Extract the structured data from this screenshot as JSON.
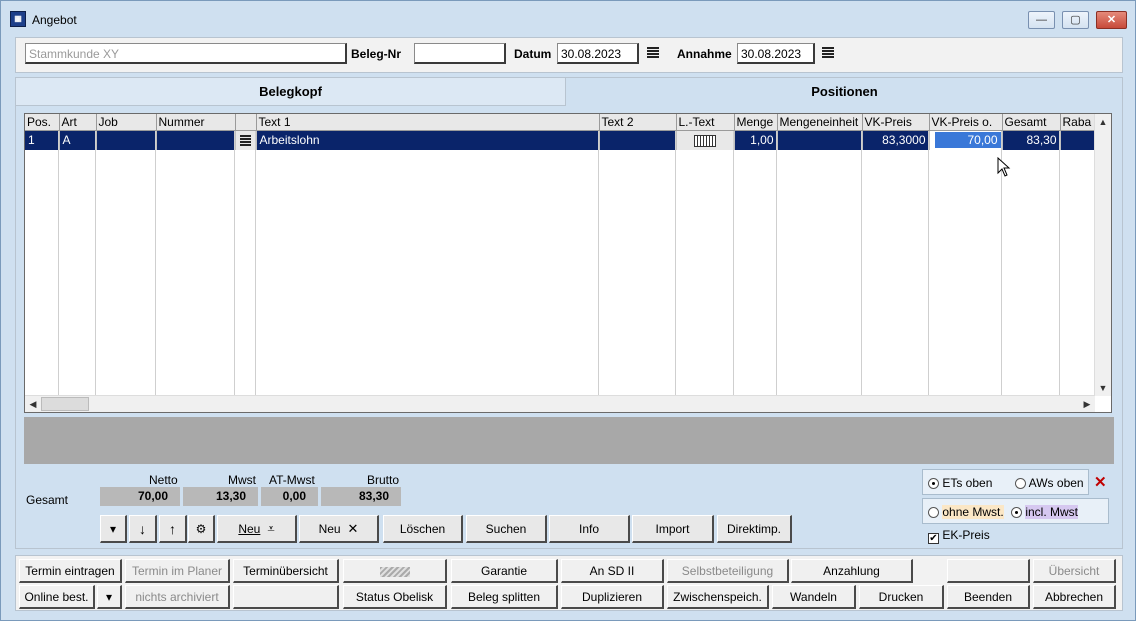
{
  "window": {
    "title": "Angebot",
    "minimize": "—",
    "maximize": "▢",
    "close": "✕"
  },
  "header": {
    "customer_placeholder": "Stammkunde XY",
    "beleg_label": "Beleg-Nr",
    "beleg_value": "",
    "datum_label": "Datum",
    "datum_value": "30.08.2023",
    "annahme_label": "Annahme",
    "annahme_value": "30.08.2023"
  },
  "tabs": [
    {
      "label": "Belegkopf",
      "active": false
    },
    {
      "label": "Positionen",
      "active": true
    }
  ],
  "grid": {
    "columns": [
      "Pos.",
      "Art",
      "Job",
      "Nummer",
      "",
      "Text 1",
      "Text 2",
      "L.-Text",
      "Menge",
      "Mengeneinheit",
      "VK-Preis",
      "VK-Preis o.",
      "Gesamt",
      "Raba"
    ],
    "rows": [
      {
        "pos": "1",
        "art": "A",
        "job": "",
        "nummer": "",
        "text1": "Arbeitslohn",
        "text2": "",
        "menge": "1,00",
        "einheit": "",
        "vk_preis": "83,3000",
        "vk_preis_o": "70,00",
        "gesamt": "83,30",
        "rabatt": ""
      }
    ]
  },
  "totals": {
    "label": "Gesamt",
    "netto_label": "Netto",
    "netto": "70,00",
    "mwst_label": "Mwst",
    "mwst": "13,30",
    "atmwst_label": "AT-Mwst",
    "atmwst": "0,00",
    "brutto_label": "Brutto",
    "brutto": "83,30"
  },
  "actions": {
    "dropdown": "▾",
    "down": "↓",
    "up": "↑",
    "settings": "⚙",
    "neu1": "Neu",
    "neu2": "Neu",
    "loeschen": "Löschen",
    "suchen": "Suchen",
    "info": "Info",
    "import": "Import",
    "direktimp": "Direktimp."
  },
  "options": {
    "ets_oben": "ETs oben",
    "aws_oben": "AWs oben",
    "ohne_mwst": "ohne Mwst.",
    "incl_mwst": "incl. Mwst",
    "ek_preis": "EK-Preis",
    "remove": "✕"
  },
  "bottom_row1": [
    {
      "label": "Termin eintragen",
      "disabled": false
    },
    {
      "label": "Termin im Planer",
      "disabled": true
    },
    {
      "label": "Terminübersicht",
      "disabled": false
    },
    {
      "label": "",
      "disabled": true
    },
    {
      "label": "Garantie",
      "disabled": false
    },
    {
      "label": "An SD II",
      "disabled": false
    },
    {
      "label": "Selbstbeteiligung",
      "disabled": true
    },
    {
      "label": "Anzahlung",
      "disabled": false
    },
    {
      "label": "",
      "disabled": true
    },
    {
      "label": "Übersicht",
      "disabled": true
    }
  ],
  "bottom_row2": [
    {
      "label": "Online best.",
      "disabled": false
    },
    {
      "label": "▾",
      "disabled": false
    },
    {
      "label": "nichts archiviert",
      "disabled": true
    },
    {
      "label": "",
      "disabled": false
    },
    {
      "label": "Status Obelisk",
      "disabled": false
    },
    {
      "label": "Beleg splitten",
      "disabled": false
    },
    {
      "label": "Duplizieren",
      "disabled": false
    },
    {
      "label": "Zwischenspeich.",
      "disabled": false
    },
    {
      "label": "Wandeln",
      "disabled": false
    },
    {
      "label": "Drucken",
      "disabled": false
    },
    {
      "label": "Beenden",
      "disabled": false
    },
    {
      "label": "Abbrechen",
      "disabled": false
    }
  ]
}
